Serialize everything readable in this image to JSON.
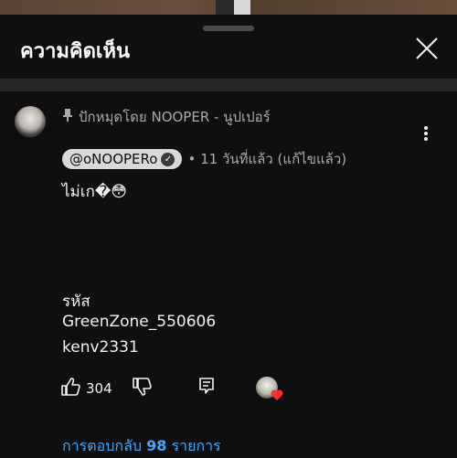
{
  "panel": {
    "title": "ความคิดเห็น"
  },
  "comment": {
    "pinned_label": "ปักหมุดโดย NOOPER - นูปเปอร์",
    "author": "@oNOOPERo",
    "meta": "• 11 วันที่แล้ว (แก้ไขแล้ว)",
    "text_line1": "ไม่เก�😳",
    "code_label": "รหัส",
    "code_1": "GreenZone_550606",
    "code_2": "kenv2331",
    "like_count": "304"
  },
  "replies": {
    "prefix": "การตอบกลับ",
    "count": "98",
    "suffix": "รายการ"
  },
  "icons": {
    "pin": "pin-icon",
    "close": "close-icon",
    "more": "more-vert-icon",
    "verified": "verified-check-icon",
    "like": "thumb-up-icon",
    "dislike": "thumb-down-icon",
    "reply": "reply-comment-icon",
    "heart": "heart-icon"
  },
  "colors": {
    "background": "#0f0f0f",
    "link": "#3ea6ff",
    "heart": "#ff2d2d"
  }
}
